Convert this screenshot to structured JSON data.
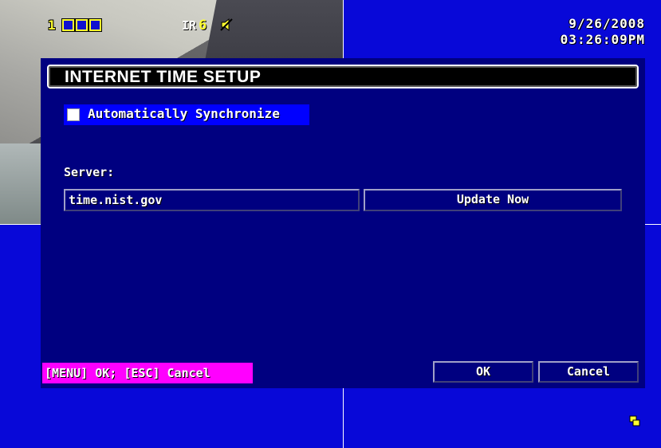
{
  "channel": {
    "number": "1"
  },
  "ir": {
    "label": "IR",
    "value": "6"
  },
  "datetime": {
    "date": "9/26/2008",
    "time": "03:26:09PM"
  },
  "dialog": {
    "title": "INTERNET TIME SETUP",
    "auto_sync_label": "Automatically Synchronize",
    "auto_sync_checked": false,
    "server_label": "Server:",
    "server_value": "time.nist.gov",
    "update_button": "Update Now",
    "hint": "[MENU] OK; [ESC] Cancel",
    "ok_button": "OK",
    "cancel_button": "Cancel"
  },
  "colors": {
    "background": "#0808d8",
    "dialog": "#000080",
    "highlight": "#0000ff",
    "hint_bg": "#ff00ff",
    "osd_yellow": "#ffff30"
  },
  "icons": {
    "mute": "speaker-muted-icon",
    "hdd": "hdd-status-icon"
  }
}
